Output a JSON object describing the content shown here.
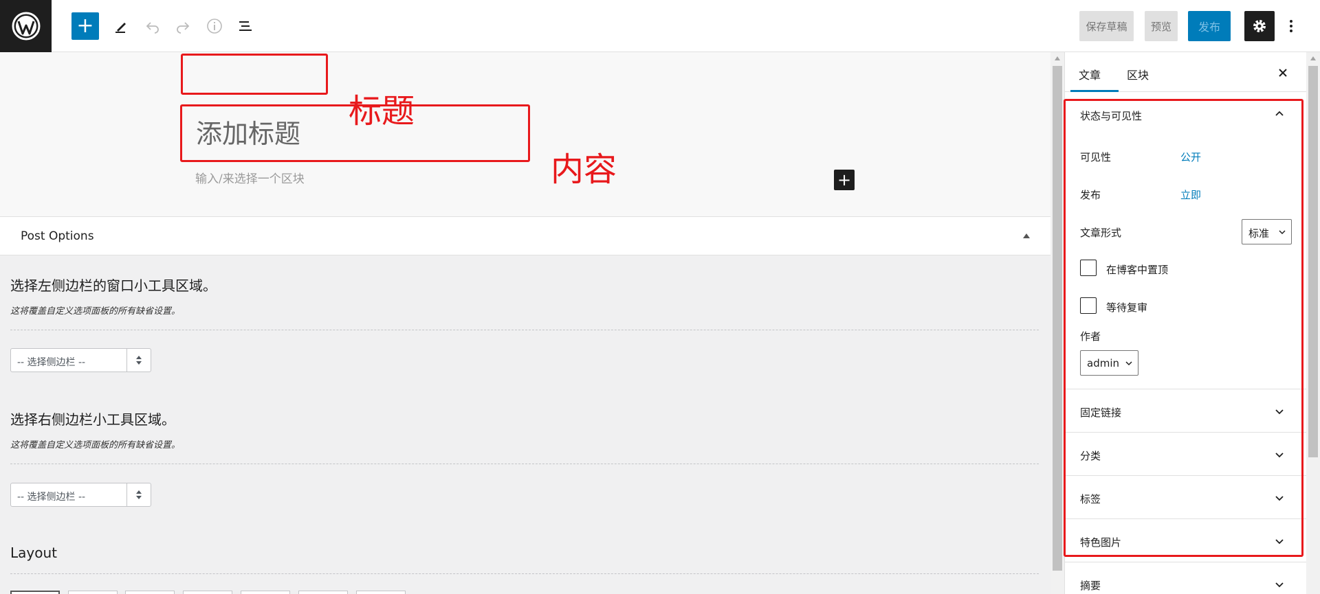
{
  "toolbar": {
    "logo_icon": "wordpress-logo-icon",
    "add_block_icon": "plus-icon",
    "save_draft_label": "保存草稿",
    "preview_label": "预览",
    "publish_label": "发布",
    "accent_color": "#007cba"
  },
  "editor": {
    "title_placeholder": "添加标题",
    "content_placeholder": "输入/来选择一个区块",
    "annotation_title": "标题",
    "annotation_content": "内容",
    "annotation_color": "#e8191c"
  },
  "metabox": {
    "title": "Post Options",
    "left_sidebar": {
      "heading": "选择左侧边栏的窗口小工具区域。",
      "description": "这将覆盖自定义选项面板的所有缺省设置。",
      "select_value": "-- 选择侧边栏 --"
    },
    "right_sidebar": {
      "heading": "选择右侧边栏小工具区域。",
      "description": "这将覆盖自定义选项面板的所有缺省设置。",
      "select_value": "-- 选择侧边栏 --"
    },
    "layout_heading": "Layout"
  },
  "sidebar": {
    "tabs": [
      {
        "label": "文章"
      },
      {
        "label": "区块"
      }
    ],
    "status_panel": {
      "title": "状态与可见性",
      "visibility_label": "可见性",
      "visibility_value": "公开",
      "publish_label": "发布",
      "publish_value": "立即",
      "format_label": "文章形式",
      "format_value": "标准",
      "sticky_label": "在博客中置顶",
      "pending_label": "等待复审",
      "author_label": "作者",
      "author_value": "admin"
    },
    "panels": [
      {
        "title": "固定链接"
      },
      {
        "title": "分类"
      },
      {
        "title": "标签"
      },
      {
        "title": "特色图片"
      },
      {
        "title": "摘要"
      }
    ]
  }
}
